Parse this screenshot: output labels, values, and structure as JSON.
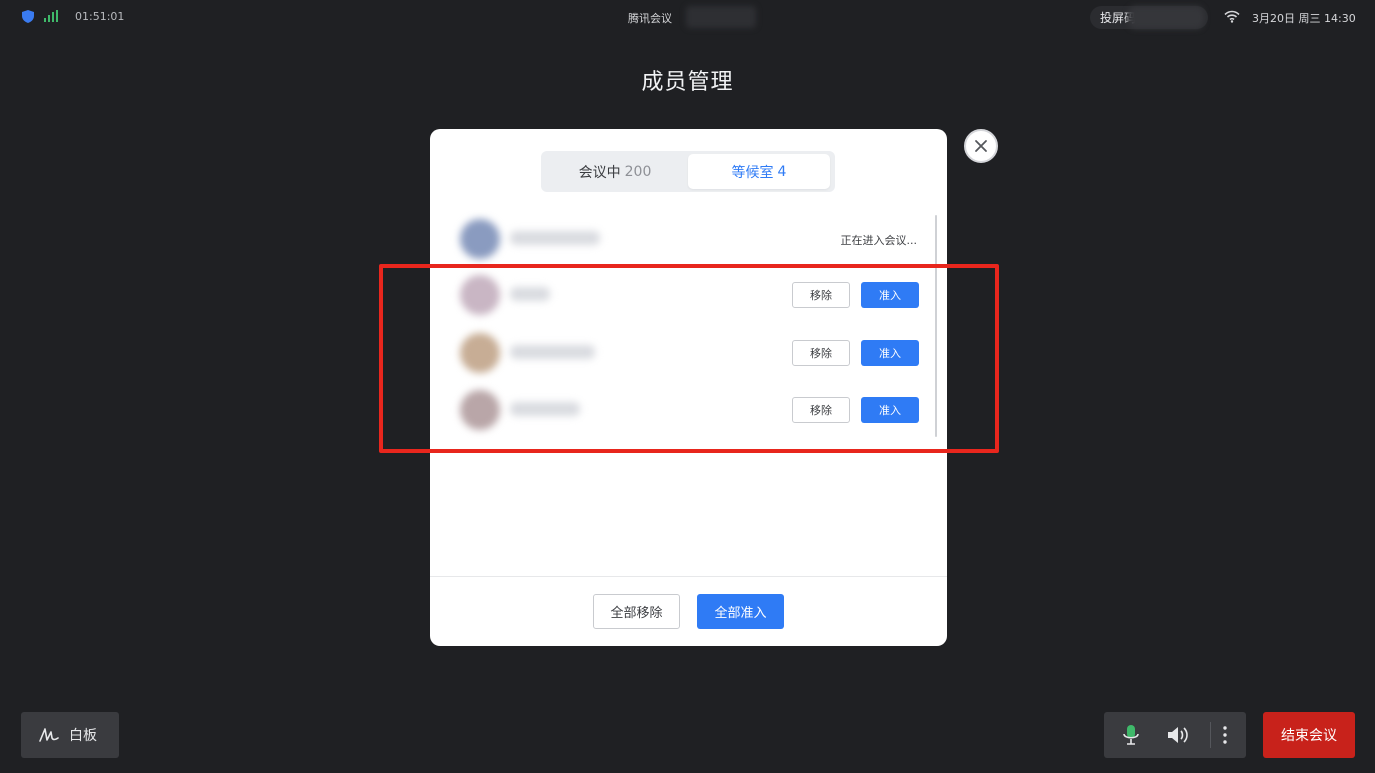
{
  "status_bar": {
    "clock": "01:51:01",
    "meeting_app": "腾讯会议",
    "cast_label": "投屏码",
    "datetime": "3月20日 周三 14:30"
  },
  "page_title": "成员管理",
  "tabs": [
    {
      "label": "会议中",
      "count": "200",
      "active": false
    },
    {
      "label": "等候室",
      "count": "4",
      "active": true
    }
  ],
  "members": [
    {
      "status": "正在进入会议..."
    },
    {
      "remove_label": "移除",
      "admit_label": "准入"
    },
    {
      "remove_label": "移除",
      "admit_label": "准入"
    },
    {
      "remove_label": "移除",
      "admit_label": "准入"
    }
  ],
  "footer": {
    "remove_all_label": "全部移除",
    "admit_all_label": "全部准入"
  },
  "toolbar": {
    "whiteboard_label": "白板",
    "end_meeting_label": "结束会议"
  },
  "colors": {
    "accent": "#2f7bf5",
    "danger": "#c8221b",
    "highlight": "#e8261d",
    "background": "#1f2023"
  }
}
